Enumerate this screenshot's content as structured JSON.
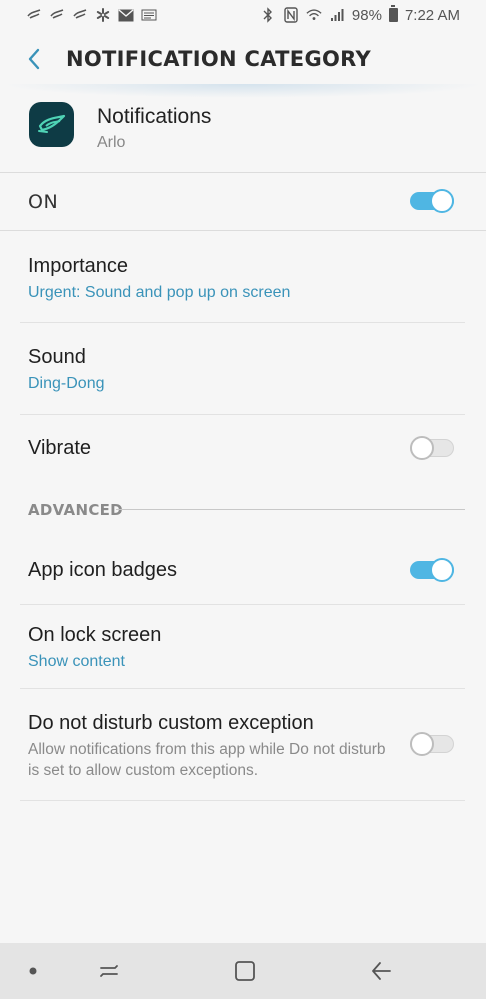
{
  "status_bar": {
    "battery": "98%",
    "time": "7:22 AM",
    "left_icons": [
      "hummingbird-icon",
      "hummingbird-icon",
      "hummingbird-icon",
      "walmart-icon",
      "mail-icon",
      "news-icon"
    ],
    "right_icons": [
      "bluetooth-icon",
      "nfc-icon",
      "wifi-icon",
      "signal-icon",
      "battery-icon"
    ]
  },
  "header": {
    "title": "NOTIFICATION CATEGORY",
    "back_icon": "back-chevron-icon"
  },
  "app": {
    "title": "Notifications",
    "subtitle": "Arlo",
    "icon": "arlo-app-icon"
  },
  "master": {
    "label": "ON",
    "enabled": true
  },
  "settings": {
    "importance": {
      "title": "Importance",
      "value": "Urgent: Sound and pop up on screen"
    },
    "sound": {
      "title": "Sound",
      "value": "Ding-Dong"
    },
    "vibrate": {
      "title": "Vibrate",
      "enabled": false
    }
  },
  "advanced": {
    "section_label": "ADVANCED",
    "badges": {
      "title": "App icon badges",
      "enabled": true
    },
    "lock_screen": {
      "title": "On lock screen",
      "value": "Show content"
    },
    "dnd": {
      "title": "Do not disturb custom exception",
      "description": "Allow notifications from this app while Do not disturb is set to allow custom exceptions.",
      "enabled": false
    }
  },
  "nav_bar": {
    "buttons": [
      "dot-icon",
      "recents-icon",
      "home-icon",
      "back-arrow-icon"
    ]
  },
  "colors": {
    "accent": "#4fb6e3",
    "link": "#3a93b9",
    "background": "#f6f6f6"
  }
}
